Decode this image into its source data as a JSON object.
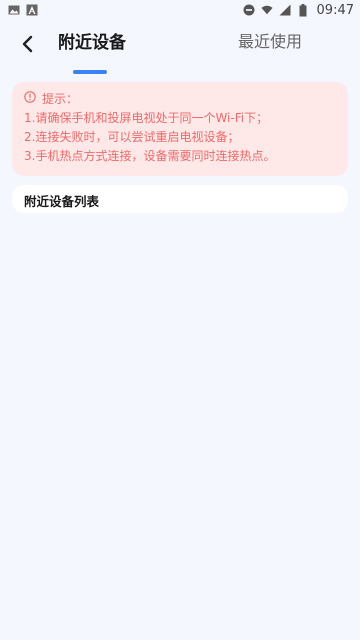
{
  "status_bar": {
    "time": "09:47",
    "icons": [
      "image-icon",
      "a-icon",
      "do-not-disturb-icon",
      "wifi-icon",
      "signal-icon",
      "battery-icon"
    ]
  },
  "header": {
    "tabs": [
      {
        "label": "附近设备",
        "active": true
      },
      {
        "label": "最近使用",
        "active": false
      }
    ],
    "accent_color": "#3b82f6"
  },
  "tip": {
    "title": "提示：",
    "lines": [
      "1.请确保手机和投屏电视处于同一个Wi-Fi下；",
      "2.连接失败时，可以尝试重启电视设备；",
      "3.手机热点方式连接，设备需要同时连接热点。"
    ],
    "color": "#ef6a6a",
    "background": "#ffe8e8"
  },
  "device_list": {
    "title": "附近设备列表"
  }
}
